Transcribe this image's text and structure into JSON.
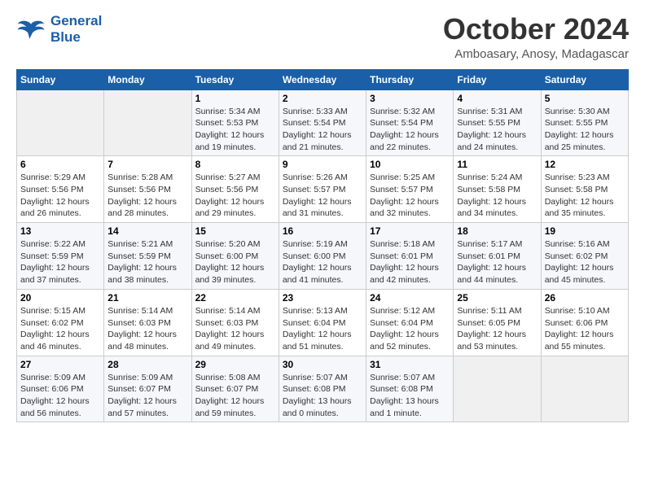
{
  "header": {
    "logo_line1": "General",
    "logo_line2": "Blue",
    "month_title": "October 2024",
    "location": "Amboasary, Anosy, Madagascar"
  },
  "days_of_week": [
    "Sunday",
    "Monday",
    "Tuesday",
    "Wednesday",
    "Thursday",
    "Friday",
    "Saturday"
  ],
  "weeks": [
    [
      {
        "day": "",
        "empty": true
      },
      {
        "day": "",
        "empty": true
      },
      {
        "day": "1",
        "sunrise": "Sunrise: 5:34 AM",
        "sunset": "Sunset: 5:53 PM",
        "daylight": "Daylight: 12 hours and 19 minutes."
      },
      {
        "day": "2",
        "sunrise": "Sunrise: 5:33 AM",
        "sunset": "Sunset: 5:54 PM",
        "daylight": "Daylight: 12 hours and 21 minutes."
      },
      {
        "day": "3",
        "sunrise": "Sunrise: 5:32 AM",
        "sunset": "Sunset: 5:54 PM",
        "daylight": "Daylight: 12 hours and 22 minutes."
      },
      {
        "day": "4",
        "sunrise": "Sunrise: 5:31 AM",
        "sunset": "Sunset: 5:55 PM",
        "daylight": "Daylight: 12 hours and 24 minutes."
      },
      {
        "day": "5",
        "sunrise": "Sunrise: 5:30 AM",
        "sunset": "Sunset: 5:55 PM",
        "daylight": "Daylight: 12 hours and 25 minutes."
      }
    ],
    [
      {
        "day": "6",
        "sunrise": "Sunrise: 5:29 AM",
        "sunset": "Sunset: 5:56 PM",
        "daylight": "Daylight: 12 hours and 26 minutes."
      },
      {
        "day": "7",
        "sunrise": "Sunrise: 5:28 AM",
        "sunset": "Sunset: 5:56 PM",
        "daylight": "Daylight: 12 hours and 28 minutes."
      },
      {
        "day": "8",
        "sunrise": "Sunrise: 5:27 AM",
        "sunset": "Sunset: 5:56 PM",
        "daylight": "Daylight: 12 hours and 29 minutes."
      },
      {
        "day": "9",
        "sunrise": "Sunrise: 5:26 AM",
        "sunset": "Sunset: 5:57 PM",
        "daylight": "Daylight: 12 hours and 31 minutes."
      },
      {
        "day": "10",
        "sunrise": "Sunrise: 5:25 AM",
        "sunset": "Sunset: 5:57 PM",
        "daylight": "Daylight: 12 hours and 32 minutes."
      },
      {
        "day": "11",
        "sunrise": "Sunrise: 5:24 AM",
        "sunset": "Sunset: 5:58 PM",
        "daylight": "Daylight: 12 hours and 34 minutes."
      },
      {
        "day": "12",
        "sunrise": "Sunrise: 5:23 AM",
        "sunset": "Sunset: 5:58 PM",
        "daylight": "Daylight: 12 hours and 35 minutes."
      }
    ],
    [
      {
        "day": "13",
        "sunrise": "Sunrise: 5:22 AM",
        "sunset": "Sunset: 5:59 PM",
        "daylight": "Daylight: 12 hours and 37 minutes."
      },
      {
        "day": "14",
        "sunrise": "Sunrise: 5:21 AM",
        "sunset": "Sunset: 5:59 PM",
        "daylight": "Daylight: 12 hours and 38 minutes."
      },
      {
        "day": "15",
        "sunrise": "Sunrise: 5:20 AM",
        "sunset": "Sunset: 6:00 PM",
        "daylight": "Daylight: 12 hours and 39 minutes."
      },
      {
        "day": "16",
        "sunrise": "Sunrise: 5:19 AM",
        "sunset": "Sunset: 6:00 PM",
        "daylight": "Daylight: 12 hours and 41 minutes."
      },
      {
        "day": "17",
        "sunrise": "Sunrise: 5:18 AM",
        "sunset": "Sunset: 6:01 PM",
        "daylight": "Daylight: 12 hours and 42 minutes."
      },
      {
        "day": "18",
        "sunrise": "Sunrise: 5:17 AM",
        "sunset": "Sunset: 6:01 PM",
        "daylight": "Daylight: 12 hours and 44 minutes."
      },
      {
        "day": "19",
        "sunrise": "Sunrise: 5:16 AM",
        "sunset": "Sunset: 6:02 PM",
        "daylight": "Daylight: 12 hours and 45 minutes."
      }
    ],
    [
      {
        "day": "20",
        "sunrise": "Sunrise: 5:15 AM",
        "sunset": "Sunset: 6:02 PM",
        "daylight": "Daylight: 12 hours and 46 minutes."
      },
      {
        "day": "21",
        "sunrise": "Sunrise: 5:14 AM",
        "sunset": "Sunset: 6:03 PM",
        "daylight": "Daylight: 12 hours and 48 minutes."
      },
      {
        "day": "22",
        "sunrise": "Sunrise: 5:14 AM",
        "sunset": "Sunset: 6:03 PM",
        "daylight": "Daylight: 12 hours and 49 minutes."
      },
      {
        "day": "23",
        "sunrise": "Sunrise: 5:13 AM",
        "sunset": "Sunset: 6:04 PM",
        "daylight": "Daylight: 12 hours and 51 minutes."
      },
      {
        "day": "24",
        "sunrise": "Sunrise: 5:12 AM",
        "sunset": "Sunset: 6:04 PM",
        "daylight": "Daylight: 12 hours and 52 minutes."
      },
      {
        "day": "25",
        "sunrise": "Sunrise: 5:11 AM",
        "sunset": "Sunset: 6:05 PM",
        "daylight": "Daylight: 12 hours and 53 minutes."
      },
      {
        "day": "26",
        "sunrise": "Sunrise: 5:10 AM",
        "sunset": "Sunset: 6:06 PM",
        "daylight": "Daylight: 12 hours and 55 minutes."
      }
    ],
    [
      {
        "day": "27",
        "sunrise": "Sunrise: 5:09 AM",
        "sunset": "Sunset: 6:06 PM",
        "daylight": "Daylight: 12 hours and 56 minutes."
      },
      {
        "day": "28",
        "sunrise": "Sunrise: 5:09 AM",
        "sunset": "Sunset: 6:07 PM",
        "daylight": "Daylight: 12 hours and 57 minutes."
      },
      {
        "day": "29",
        "sunrise": "Sunrise: 5:08 AM",
        "sunset": "Sunset: 6:07 PM",
        "daylight": "Daylight: 12 hours and 59 minutes."
      },
      {
        "day": "30",
        "sunrise": "Sunrise: 5:07 AM",
        "sunset": "Sunset: 6:08 PM",
        "daylight": "Daylight: 13 hours and 0 minutes."
      },
      {
        "day": "31",
        "sunrise": "Sunrise: 5:07 AM",
        "sunset": "Sunset: 6:08 PM",
        "daylight": "Daylight: 13 hours and 1 minute."
      },
      {
        "day": "",
        "empty": true
      },
      {
        "day": "",
        "empty": true
      }
    ]
  ]
}
